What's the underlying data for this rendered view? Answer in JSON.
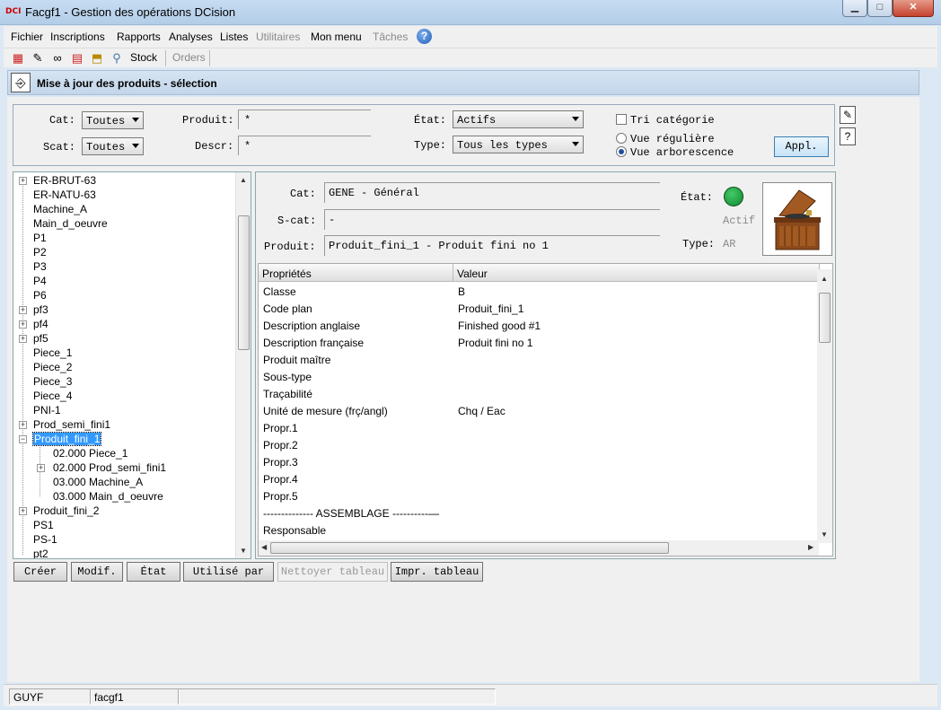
{
  "window": {
    "title": "Facgf1 - Gestion des opérations DCision",
    "logo_text": "DCI",
    "minimize": "▁",
    "maximize": "□",
    "close": "✕"
  },
  "menu": {
    "items": [
      "Fichier",
      "Inscriptions",
      "Rapports",
      "Analyses",
      "Listes",
      "Utilitaires",
      "Mon menu",
      "Tâches"
    ],
    "help": "?"
  },
  "toolbar": {
    "stock_label": "Stock",
    "orders_label": "Orders"
  },
  "page": {
    "title": "Mise à jour des produits - sélection"
  },
  "filters": {
    "cat_label": "Cat:",
    "cat_value": "Toutes",
    "scat_label": "Scat:",
    "scat_value": "Toutes",
    "produit_label": "Produit:",
    "produit_value": "*",
    "descr_label": "Descr:",
    "descr_value": "*",
    "etat_label": "État:",
    "etat_value": "Actifs",
    "type_label": "Type:",
    "type_value": "Tous les types",
    "tri_label": "Tri catégorie",
    "vue_reguliere": "Vue régulière",
    "vue_arborescence": "Vue arborescence",
    "appl_label": "Appl."
  },
  "tree": {
    "items": [
      {
        "label": "ER-BRUT-63",
        "expandable": true
      },
      {
        "label": "ER-NATU-63",
        "expandable": false
      },
      {
        "label": "Machine_A",
        "expandable": false
      },
      {
        "label": "Main_d_oeuvre",
        "expandable": false
      },
      {
        "label": "P1",
        "expandable": false
      },
      {
        "label": "P2",
        "expandable": false
      },
      {
        "label": "P3",
        "expandable": false
      },
      {
        "label": "P4",
        "expandable": false
      },
      {
        "label": "P6",
        "expandable": false
      },
      {
        "label": "pf3",
        "expandable": true
      },
      {
        "label": "pf4",
        "expandable": true
      },
      {
        "label": "pf5",
        "expandable": true
      },
      {
        "label": "Piece_1",
        "expandable": false
      },
      {
        "label": "Piece_2",
        "expandable": false
      },
      {
        "label": "Piece_3",
        "expandable": false
      },
      {
        "label": "Piece_4",
        "expandable": false
      },
      {
        "label": "PNI-1",
        "expandable": false
      },
      {
        "label": "Prod_semi_fini1",
        "expandable": true
      },
      {
        "label": "Produit_fini_1",
        "expandable": true,
        "expanded": true,
        "selected": true
      },
      {
        "label": "02.000 Piece_1",
        "child": true,
        "expandable": false
      },
      {
        "label": "02.000 Prod_semi_fini1",
        "child": true,
        "expandable": true
      },
      {
        "label": "03.000 Machine_A",
        "child": true,
        "expandable": false
      },
      {
        "label": "03.000 Main_d_oeuvre",
        "child": true,
        "expandable": false
      },
      {
        "label": "Produit_fini_2",
        "expandable": true
      },
      {
        "label": "PS1",
        "expandable": false
      },
      {
        "label": "PS-1",
        "expandable": false
      },
      {
        "label": "pt2",
        "expandable": false
      }
    ]
  },
  "detail": {
    "cat_label": "Cat:",
    "cat_value": "GENE - Général",
    "scat_label": "S-cat:",
    "scat_value": "-",
    "produit_label": "Produit:",
    "produit_value": "Produit_fini_1 - Produit fini no 1",
    "etat_label": "État:",
    "etat_value": "Actif",
    "status_color": "#1aa33c",
    "type_label": "Type:",
    "type_value": "AR",
    "image_icon": "gramophone-image"
  },
  "properties": {
    "col_prop": "Propriétés",
    "col_val": "Valeur",
    "rows": [
      {
        "k": "Classe",
        "v": "B"
      },
      {
        "k": "Code plan",
        "v": "Produit_fini_1"
      },
      {
        "k": "Description anglaise",
        "v": "Finished good #1"
      },
      {
        "k": "Description française",
        "v": "Produit fini no 1"
      },
      {
        "k": "Produit maître",
        "v": ""
      },
      {
        "k": "Sous-type",
        "v": ""
      },
      {
        "k": "Traçabilité",
        "v": ""
      },
      {
        "k": "Unité de mesure (frç/angl)",
        "v": "Chq / Eac"
      },
      {
        "k": "Propr.1",
        "v": ""
      },
      {
        "k": "Propr.2",
        "v": ""
      },
      {
        "k": "Propr.3",
        "v": ""
      },
      {
        "k": "Propr.4",
        "v": ""
      },
      {
        "k": "Propr.5",
        "v": ""
      },
      {
        "k": "-------------- ASSEMBLAGE ----------—",
        "v": ""
      },
      {
        "k": "Responsable",
        "v": ""
      }
    ]
  },
  "buttons": {
    "creer": "Créer",
    "modif": "Modif.",
    "etat": "État",
    "utilise_par": "Utilisé par",
    "nettoyer": "Nettoyer tableau",
    "impr": "Impr. tableau"
  },
  "statusbar": {
    "user": "GUYF",
    "db": "facgf1"
  }
}
